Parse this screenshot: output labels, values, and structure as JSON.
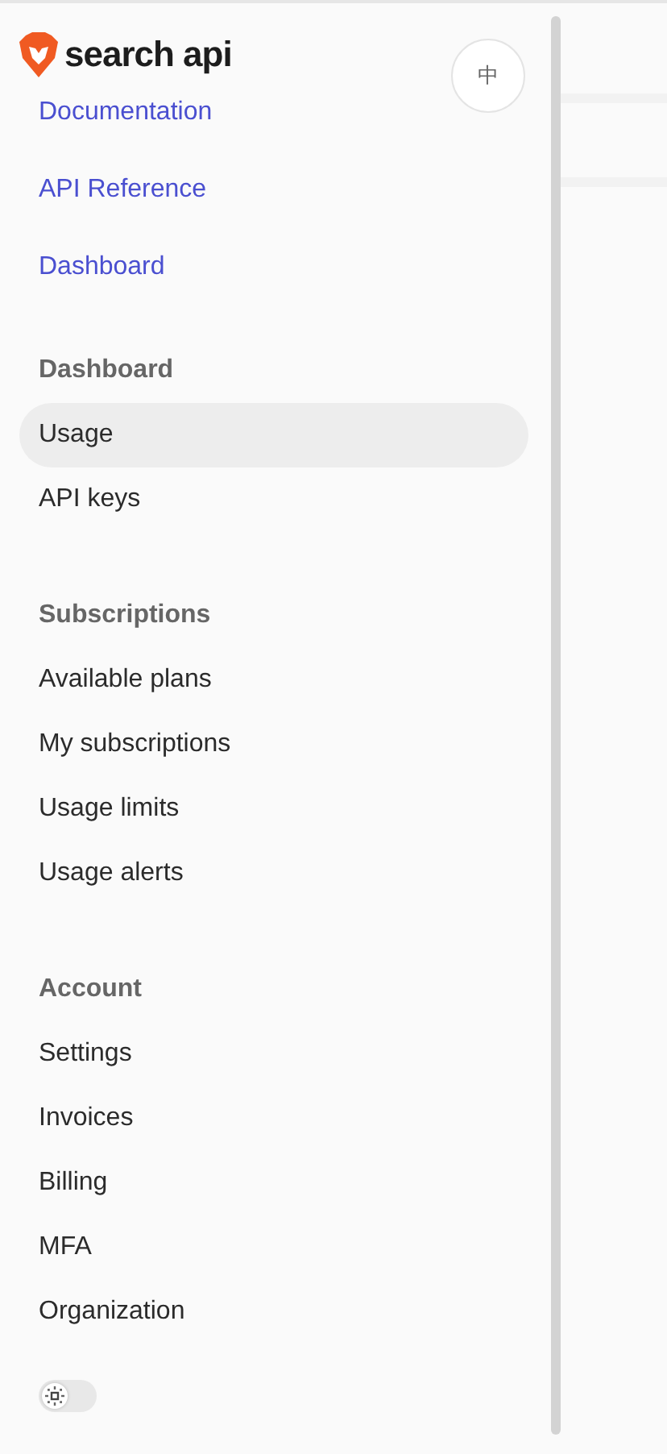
{
  "logo": {
    "text": "search api"
  },
  "language_button": {
    "label": "中"
  },
  "top_links": [
    {
      "label": "Documentation"
    },
    {
      "label": "API Reference"
    },
    {
      "label": "Dashboard"
    }
  ],
  "sections": [
    {
      "title": "Dashboard",
      "items": [
        {
          "label": "Usage",
          "selected": true
        },
        {
          "label": "API keys",
          "selected": false
        }
      ]
    },
    {
      "title": "Subscriptions",
      "items": [
        {
          "label": "Available plans",
          "selected": false
        },
        {
          "label": "My subscriptions",
          "selected": false
        },
        {
          "label": "Usage limits",
          "selected": false
        },
        {
          "label": "Usage alerts",
          "selected": false
        }
      ]
    },
    {
      "title": "Account",
      "items": [
        {
          "label": "Settings",
          "selected": false
        },
        {
          "label": "Invoices",
          "selected": false
        },
        {
          "label": "Billing",
          "selected": false
        },
        {
          "label": "MFA",
          "selected": false
        },
        {
          "label": "Organization",
          "selected": false
        }
      ]
    }
  ],
  "theme_toggle": {
    "on": false
  }
}
